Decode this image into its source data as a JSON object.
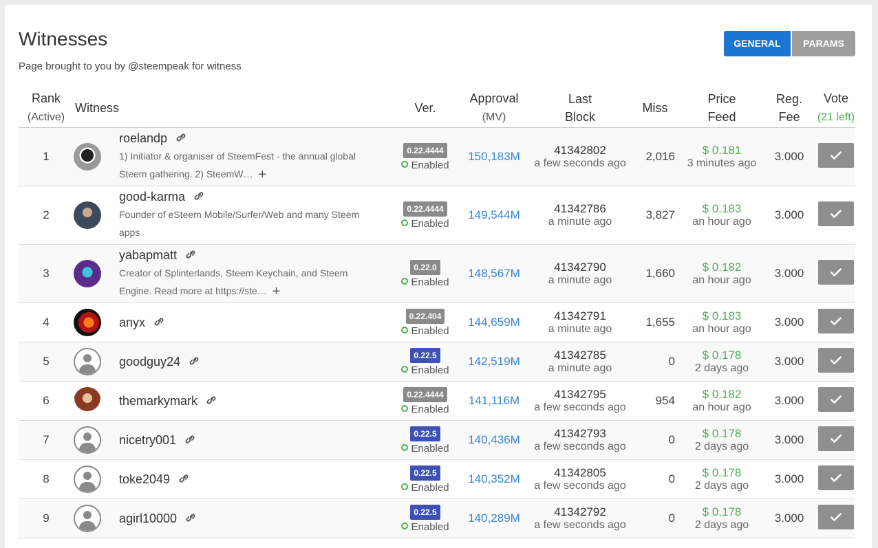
{
  "page": {
    "title": "Witnesses",
    "subtitle": "Page brought to you by @steempeak for witness",
    "tabs": [
      {
        "label": "GENERAL",
        "active": true
      },
      {
        "label": "PARAMS",
        "active": false
      }
    ]
  },
  "headers": {
    "rank": "Rank",
    "rank_sub": "(Active)",
    "witness": "Witness",
    "ver": "Ver.",
    "approval": "Approval",
    "approval_sub": "(MV)",
    "last": "Last",
    "block": "Block",
    "miss": "Miss",
    "price": "Price",
    "feed": "Feed",
    "reg": "Reg.",
    "fee": "Fee",
    "vote": "Vote",
    "vote_left": "(21 left)"
  },
  "colors": {
    "accent": "#1976d2",
    "green": "#4caf50",
    "link": "#3a85d6",
    "badge_grey": "#8a8a8a",
    "badge_blue": "#3f51b5"
  },
  "witnesses": [
    {
      "rank": "1",
      "name": "roelandp",
      "desc": "1) Initiator & organiser of SteemFest - the annual global Steem gathering. 2) SteemW…",
      "more": true,
      "version": "0.22.4444",
      "status": "Enabled",
      "approval": "150,183M",
      "block": "41342802",
      "block_time": "a few seconds ago",
      "miss": "2,016",
      "price": "$ 0.181",
      "price_time": "3 minutes ago",
      "fee": "3.000",
      "avatar": "custom-photo"
    },
    {
      "rank": "2",
      "name": "good-karma",
      "desc": "Founder of eSteem Mobile/Surfer/Web and many Steem apps",
      "more": false,
      "version": "0.22.4444",
      "status": "Enabled",
      "approval": "149,544M",
      "block": "41342786",
      "block_time": "a minute ago",
      "miss": "3,827",
      "price": "$ 0.183",
      "price_time": "an hour ago",
      "fee": "3.000",
      "avatar": "custom-photo"
    },
    {
      "rank": "3",
      "name": "yabapmatt",
      "desc": "Creator of Splinterlands, Steem Keychain, and Steem Engine. Read more at https://ste…",
      "more": true,
      "version": "0.22.0",
      "status": "Enabled",
      "approval": "148,567M",
      "block": "41342790",
      "block_time": "a minute ago",
      "miss": "1,660",
      "price": "$ 0.182",
      "price_time": "an hour ago",
      "fee": "3.000",
      "avatar": "custom-photo"
    },
    {
      "rank": "4",
      "name": "anyx",
      "version": "0.22.404",
      "status": "Enabled",
      "approval": "144,659M",
      "block": "41342791",
      "block_time": "a minute ago",
      "miss": "1,655",
      "price": "$ 0.183",
      "price_time": "an hour ago",
      "fee": "3.000",
      "avatar": "custom-photo"
    },
    {
      "rank": "5",
      "name": "goodguy24",
      "version": "0.22.5",
      "status": "Enabled",
      "approval": "142,519M",
      "block": "41342785",
      "block_time": "a minute ago",
      "miss": "0",
      "price": "$ 0.178",
      "price_time": "2 days ago",
      "fee": "3.000",
      "avatar": "default"
    },
    {
      "rank": "6",
      "name": "themarkymark",
      "version": "0.22.4444",
      "status": "Enabled",
      "approval": "141,116M",
      "block": "41342795",
      "block_time": "a few seconds ago",
      "miss": "954",
      "price": "$ 0.182",
      "price_time": "an hour ago",
      "fee": "3.000",
      "avatar": "custom-photo"
    },
    {
      "rank": "7",
      "name": "nicetry001",
      "version": "0.22.5",
      "status": "Enabled",
      "approval": "140,436M",
      "block": "41342793",
      "block_time": "a few seconds ago",
      "miss": "0",
      "price": "$ 0.178",
      "price_time": "2 days ago",
      "fee": "3.000",
      "avatar": "default"
    },
    {
      "rank": "8",
      "name": "toke2049",
      "version": "0.22.5",
      "status": "Enabled",
      "approval": "140,352M",
      "block": "41342805",
      "block_time": "a few seconds ago",
      "miss": "0",
      "price": "$ 0.178",
      "price_time": "2 days ago",
      "fee": "3.000",
      "avatar": "default"
    },
    {
      "rank": "9",
      "name": "agirl10000",
      "version": "0.22.5",
      "status": "Enabled",
      "approval": "140,289M",
      "block": "41342792",
      "block_time": "a few seconds ago",
      "miss": "0",
      "price": "$ 0.178",
      "price_time": "2 days ago",
      "fee": "3.000",
      "avatar": "default"
    }
  ]
}
